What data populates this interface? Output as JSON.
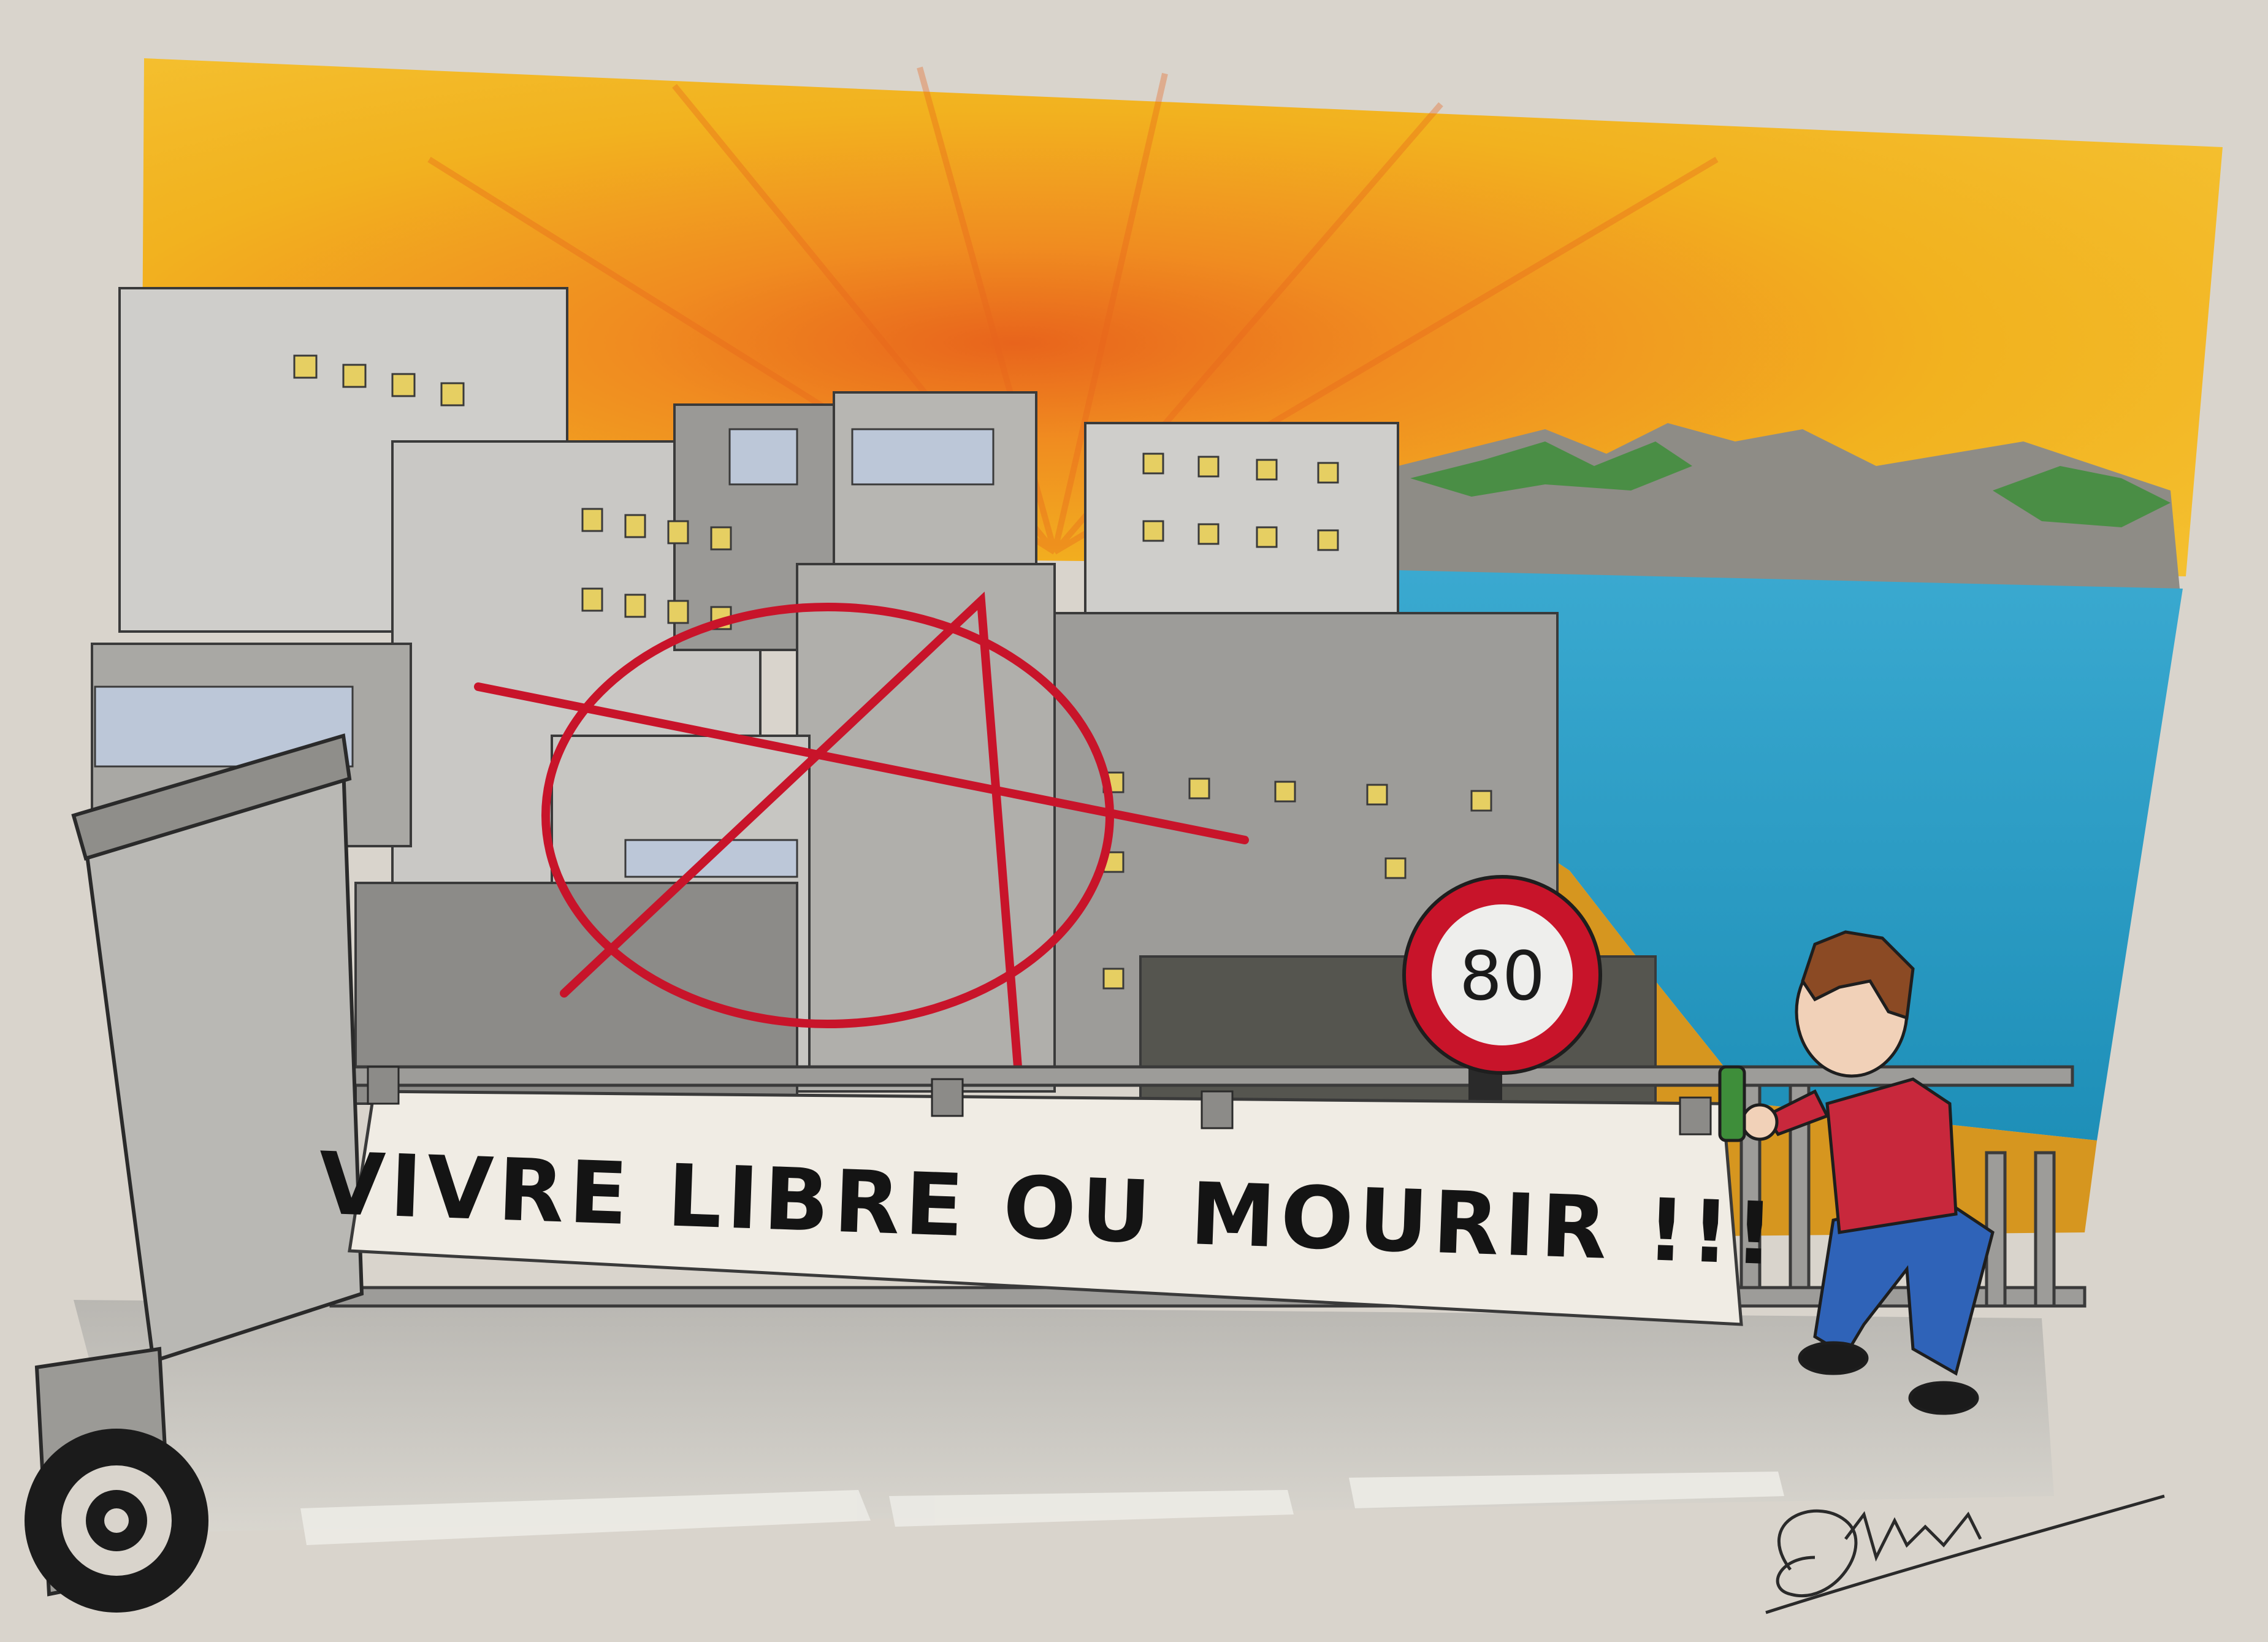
{
  "artwork": {
    "banner_text": "VIVRE LIBRE OU MOURIR !!!",
    "speed_sign_value": "80",
    "signature": "Dahrlyss"
  },
  "colors": {
    "paper": "#d9d4cc",
    "sky": "#f2b21f",
    "sun_glow": "#e8641c",
    "sea": "#2aa4c8",
    "sand": "#d6961f",
    "mountains": "#8e8c86",
    "vegetation": "#3e8e3a",
    "buildings": "#c9c8c5",
    "windows": "#e6cf62",
    "graffiti": "#c8142a",
    "shirt": "#c8283c",
    "jeans": "#2f63b8"
  }
}
